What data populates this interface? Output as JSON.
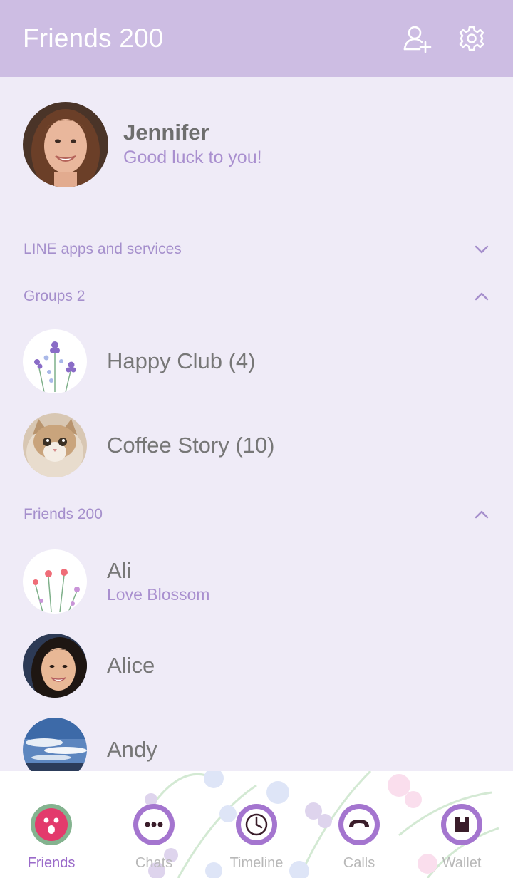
{
  "header": {
    "title": "Friends 200",
    "add_friend_icon": "add-friend-icon",
    "settings_icon": "gear-icon"
  },
  "profile": {
    "name": "Jennifer",
    "status": "Good luck to you!"
  },
  "sections": {
    "apps": {
      "label": "LINE apps and services",
      "state": "collapsed"
    },
    "groups": {
      "label": "Groups 2",
      "state": "expanded"
    },
    "friends": {
      "label": "Friends 200",
      "state": "expanded"
    }
  },
  "groups": [
    {
      "name": "Happy Club (4)"
    },
    {
      "name": "Coffee Story (10)"
    }
  ],
  "friends": [
    {
      "name": "Ali",
      "status": "Love Blossom"
    },
    {
      "name": "Alice",
      "status": ""
    },
    {
      "name": "Andy",
      "status": ""
    }
  ],
  "nav": {
    "items": [
      {
        "label": "Friends",
        "icon": "friends-face-icon",
        "active": true
      },
      {
        "label": "Chats",
        "icon": "chat-dots-icon",
        "active": false
      },
      {
        "label": "Timeline",
        "icon": "clock-icon",
        "active": false
      },
      {
        "label": "Calls",
        "icon": "phone-icon",
        "active": false
      },
      {
        "label": "Wallet",
        "icon": "wallet-icon",
        "active": false
      }
    ]
  },
  "colors": {
    "header_bg": "#cdbde3",
    "page_bg": "#efebf7",
    "accent": "#a98fcf",
    "active_nav": "#9a6ac9"
  }
}
